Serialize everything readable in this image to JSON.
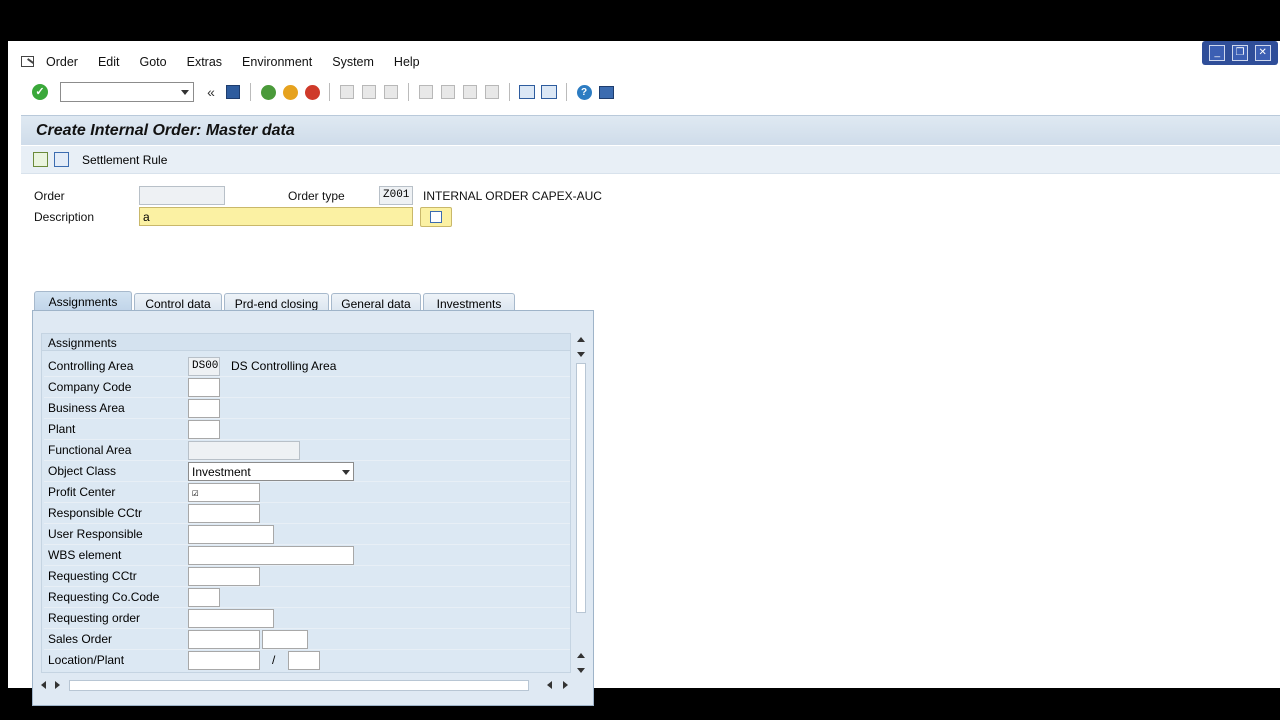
{
  "window_controls": {
    "minimize": "_",
    "restore": "❐",
    "close": "✕"
  },
  "menu": [
    "Order",
    "Edit",
    "Goto",
    "Extras",
    "Environment",
    "System",
    "Help"
  ],
  "title": "Create Internal Order: Master data",
  "app_toolbar": {
    "settlement_rule": "Settlement Rule"
  },
  "header": {
    "order_label": "Order",
    "order_value": "",
    "order_type_label": "Order type",
    "order_type_value": "Z001",
    "order_type_text": "INTERNAL ORDER CAPEX-AUC",
    "description_label": "Description",
    "description_value": "a"
  },
  "tabs": [
    "Assignments",
    "Control data",
    "Prd-end closing",
    "General data",
    "Investments"
  ],
  "group_title": "Assignments",
  "rows": [
    {
      "label": "Controlling Area",
      "value": "DS00",
      "text": "DS Controlling Area"
    },
    {
      "label": "Company Code",
      "value": ""
    },
    {
      "label": "Business Area",
      "value": ""
    },
    {
      "label": "Plant",
      "value": ""
    },
    {
      "label": "Functional Area",
      "value": ""
    },
    {
      "label": "Object Class",
      "value": "Investment"
    },
    {
      "label": "Profit Center",
      "value": "☑"
    },
    {
      "label": "Responsible CCtr",
      "value": ""
    },
    {
      "label": "User Responsible",
      "value": ""
    },
    {
      "label": "WBS element",
      "value": ""
    },
    {
      "label": "Requesting CCtr",
      "value": ""
    },
    {
      "label": "Requesting Co.Code",
      "value": ""
    },
    {
      "label": "Requesting order",
      "value": ""
    },
    {
      "label": "Sales Order",
      "value": ""
    },
    {
      "label": "Location/Plant",
      "value": "",
      "sep": "/"
    }
  ],
  "colors": {
    "title_bg": "#dfe9f2",
    "panel_bg": "#dfe9f3",
    "active_field": "#fbf1a3",
    "ok_green": "#3aa83a"
  },
  "icons": [
    "enter-icon",
    "back-icon",
    "save-icon",
    "back-nav-icon",
    "exit-icon",
    "cancel-icon",
    "print-icon",
    "find-icon",
    "find-next-icon",
    "first-page-icon",
    "prev-page-icon",
    "next-page-icon",
    "last-page-icon",
    "new-session-icon",
    "shortcut-icon",
    "help-icon",
    "layout-icon"
  ]
}
